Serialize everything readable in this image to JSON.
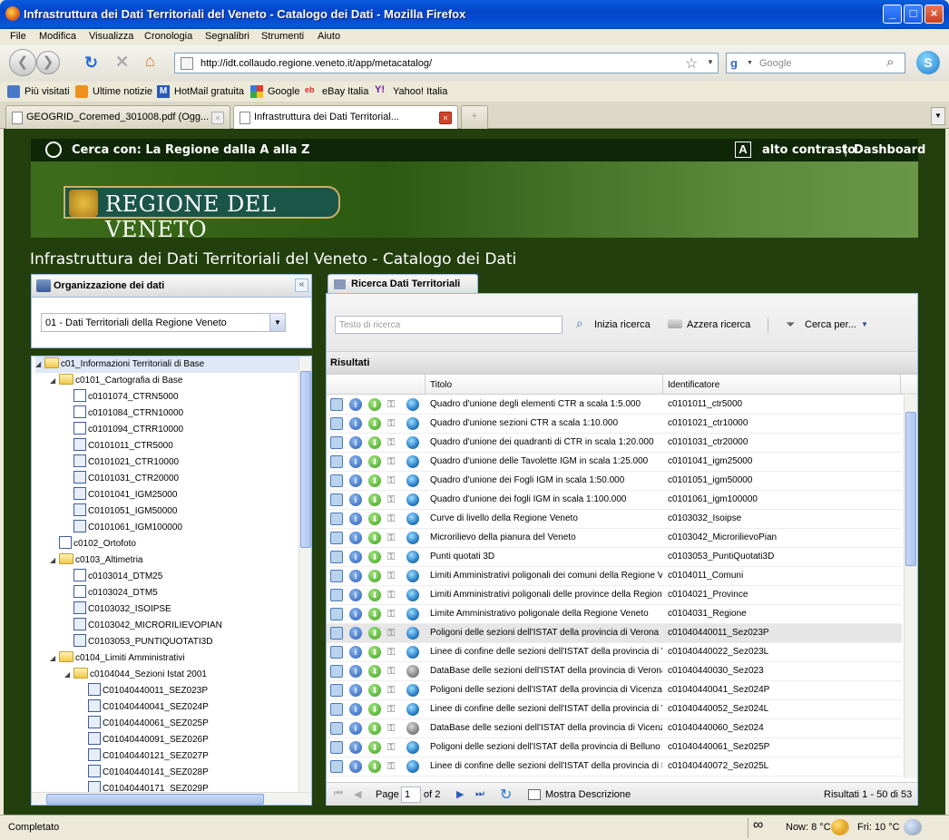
{
  "window": {
    "title": "Infrastruttura dei Dati Territoriali del Veneto - Catalogo dei Dati - Mozilla Firefox"
  },
  "menu": [
    "File",
    "Modifica",
    "Visualizza",
    "Cronologia",
    "Segnalibri",
    "Strumenti",
    "Aiuto"
  ],
  "nav": {
    "url": "http://idt.collaudo.regione.veneto.it/app/metacatalog/",
    "search_placeholder": "Google"
  },
  "bookmarks": [
    "Più visitati",
    "Ultime notizie",
    "HotMail gratuita",
    "Google",
    "eBay Italia",
    "Yahoo! Italia"
  ],
  "tabs": [
    "GEOGRID_Coremed_301008.pdf (Ogg...",
    "Infrastruttura dei Dati Territorial..."
  ],
  "site": {
    "search_label": "Cerca con: La Regione dalla A alla Z",
    "contrast": "alto contrasto",
    "sep": "|",
    "dashboard": "Dashboard",
    "logo": "REGIONE DEL VENETO",
    "page_title": "Infrastruttura dei Dati Territoriali del Veneto - Catalogo dei Dati"
  },
  "left_panel": {
    "title": "Organizzazione dei dati",
    "select_value": "01 - Dati Territoriali della Regione Veneto"
  },
  "tree": [
    {
      "label": "c01_Informazioni Territoriali di Base",
      "level": 0,
      "type": "folder",
      "open": true,
      "selected": true
    },
    {
      "label": "c0101_Cartografia di Base",
      "level": 1,
      "type": "folder",
      "open": true
    },
    {
      "label": "c0101074_CTRN5000",
      "level": 2,
      "type": "layer"
    },
    {
      "label": "c0101084_CTRN10000",
      "level": 2,
      "type": "layer"
    },
    {
      "label": "c0101094_CTRR10000",
      "level": 2,
      "type": "layer"
    },
    {
      "label": "C0101011_CTR5000",
      "level": 2,
      "type": "layer2"
    },
    {
      "label": "C0101021_CTR10000",
      "level": 2,
      "type": "layer2"
    },
    {
      "label": "C0101031_CTR20000",
      "level": 2,
      "type": "layer2"
    },
    {
      "label": "C0101041_IGM25000",
      "level": 2,
      "type": "layer2"
    },
    {
      "label": "C0101051_IGM50000",
      "level": 2,
      "type": "layer2"
    },
    {
      "label": "C0101061_IGM100000",
      "level": 2,
      "type": "layer2"
    },
    {
      "label": "c0102_Ortofoto",
      "level": 1,
      "type": "layer"
    },
    {
      "label": "c0103_Altimetria",
      "level": 1,
      "type": "folder",
      "open": true
    },
    {
      "label": "c0103014_DTM25",
      "level": 2,
      "type": "layer"
    },
    {
      "label": "c0103024_DTM5",
      "level": 2,
      "type": "layer"
    },
    {
      "label": "C0103032_ISOIPSE",
      "level": 2,
      "type": "layer2"
    },
    {
      "label": "C0103042_MICRORILIEVOPIAN",
      "level": 2,
      "type": "layer2"
    },
    {
      "label": "C0103053_PUNTIQUOTATI3D",
      "level": 2,
      "type": "layer2"
    },
    {
      "label": "c0104_Limiti Amministrativi",
      "level": 1,
      "type": "folder",
      "open": true
    },
    {
      "label": "c0104044_Sezioni Istat 2001",
      "level": 2,
      "type": "folder",
      "open": true
    },
    {
      "label": "C01040440011_SEZ023P",
      "level": 3,
      "type": "layer2"
    },
    {
      "label": "C01040440041_SEZ024P",
      "level": 3,
      "type": "layer2"
    },
    {
      "label": "C01040440061_SEZ025P",
      "level": 3,
      "type": "layer2"
    },
    {
      "label": "C01040440091_SEZ026P",
      "level": 3,
      "type": "layer2"
    },
    {
      "label": "C01040440121_SEZ027P",
      "level": 3,
      "type": "layer2"
    },
    {
      "label": "C01040440141_SEZ028P",
      "level": 3,
      "type": "layer2"
    },
    {
      "label": "C01040440171_SEZ029P",
      "level": 3,
      "type": "layer2"
    }
  ],
  "right_panel": {
    "tab": "Ricerca Dati Territoriali",
    "search_placeholder": "Testo di ricerca",
    "btn_search": "Inizia ricerca",
    "btn_reset": "Azzera ricerca",
    "btn_filter": "Cerca per...",
    "results_label": "Risultati",
    "col_title": "Titolo",
    "col_id": "Identificatore"
  },
  "rows": [
    {
      "title": "Quadro d'unione degli elementi CTR a scala 1:5.000",
      "id": "c0101011_ctr5000",
      "globe": "blue"
    },
    {
      "title": "Quadro d'unione sezioni CTR a scala 1:10.000",
      "id": "c0101021_ctr10000",
      "globe": "blue"
    },
    {
      "title": "Quadro d'unione dei quadranti di CTR in scala 1:20.000",
      "id": "c0101031_ctr20000",
      "globe": "blue"
    },
    {
      "title": "Quadro d'unione delle Tavolette IGM in scala 1:25.000",
      "id": "c0101041_igm25000",
      "globe": "blue"
    },
    {
      "title": "Quadro d'unione dei Fogli IGM in scala 1:50.000",
      "id": "c0101051_igm50000",
      "globe": "blue"
    },
    {
      "title": "Quadro d'unione dei fogli IGM in scala 1:100.000",
      "id": "c0101061_igm100000",
      "globe": "blue"
    },
    {
      "title": "Curve di livello della Regione Veneto",
      "id": "c0103032_Isoipse",
      "globe": "blue"
    },
    {
      "title": "Microrilievo della pianura del Veneto",
      "id": "c0103042_MicrorilievoPian",
      "globe": "blue"
    },
    {
      "title": "Punti quotati 3D",
      "id": "c0103053_PuntiQuotati3D",
      "globe": "blue"
    },
    {
      "title": "Limiti Amministrativi poligonali dei comuni della Regione Veneto",
      "id": "c0104011_Comuni",
      "globe": "blue"
    },
    {
      "title": "Limiti Amministrativi poligonali delle province della Regione Veneto",
      "id": "c0104021_Province",
      "globe": "blue"
    },
    {
      "title": "Limite Amministrativo poligonale della Regione Veneto",
      "id": "c0104031_Regione",
      "globe": "blue"
    },
    {
      "title": "Poligoni delle sezioni dell'ISTAT della provincia di Verona",
      "id": "c01040440011_Sez023P",
      "globe": "blue",
      "selected": true
    },
    {
      "title": "Linee di confine delle sezioni dell'ISTAT della provincia di Verona",
      "id": "c01040440022_Sez023L",
      "globe": "blue"
    },
    {
      "title": "DataBase delle sezioni dell'ISTAT della provincia di Verona",
      "id": "c01040440030_Sez023",
      "globe": "grey"
    },
    {
      "title": "Poligoni delle sezioni dell'ISTAT della provincia di Vicenza",
      "id": "c01040440041_Sez024P",
      "globe": "blue"
    },
    {
      "title": "Linee di confine delle sezioni dell'ISTAT della provincia di Vicenza",
      "id": "c01040440052_Sez024L",
      "globe": "blue"
    },
    {
      "title": "DataBase delle sezioni dell'ISTAT della provincia di Vicenza",
      "id": "c01040440060_Sez024",
      "globe": "grey"
    },
    {
      "title": "Poligoni delle sezioni dell'ISTAT della provincia di Belluno",
      "id": "c01040440061_Sez025P",
      "globe": "blue"
    },
    {
      "title": "Linee di confine delle sezioni dell'ISTAT della provincia di Belluno",
      "id": "c01040440072_Sez025L",
      "globe": "blue"
    }
  ],
  "pager": {
    "page_label": "Page",
    "page_value": "1",
    "of_label": "of 2",
    "mostra": "Mostra Descrizione",
    "results": "Risultati 1 - 50 di 53"
  },
  "status": {
    "text": "Completato",
    "weather_now": "Now: 8 °C",
    "weather_fri": "Fri: 10 °C"
  }
}
